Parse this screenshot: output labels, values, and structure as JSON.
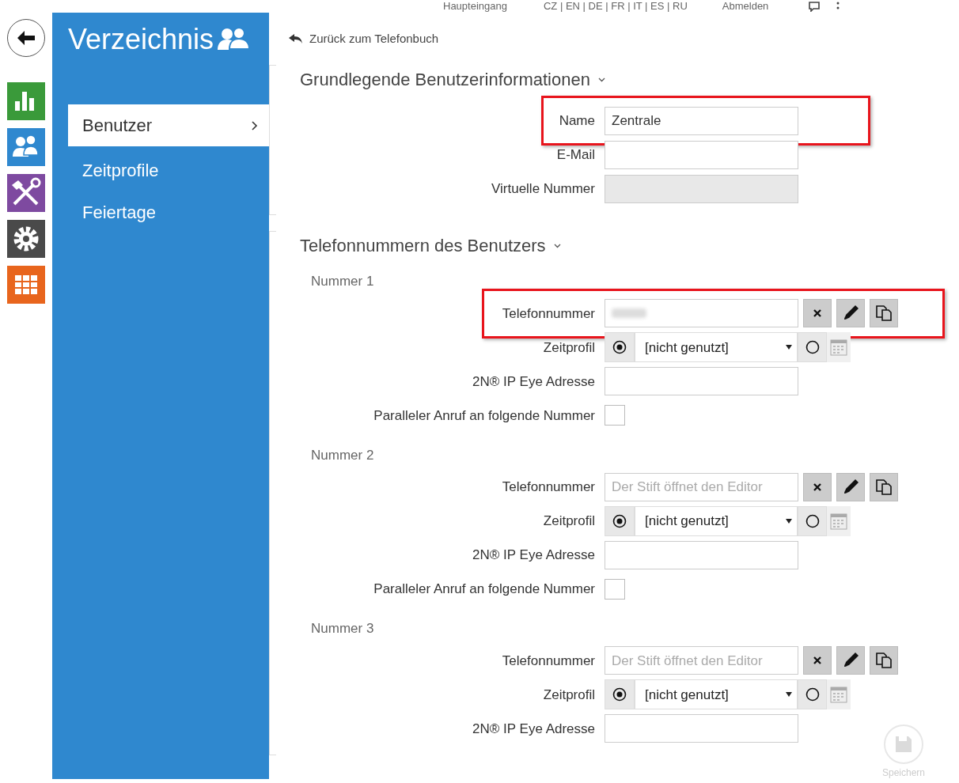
{
  "top_bar": {
    "items": [
      "Haupteingang",
      "CZ | EN | DE | FR | IT | ES | RU",
      "Abmelden"
    ]
  },
  "rail": {
    "items": [
      {
        "kind": "back"
      },
      {
        "kind": "status"
      },
      {
        "kind": "directory"
      },
      {
        "kind": "hardware"
      },
      {
        "kind": "system"
      },
      {
        "kind": "services"
      }
    ]
  },
  "sidebar": {
    "title": "Verzeichnis",
    "items": [
      {
        "label": "Benutzer",
        "selected": true
      },
      {
        "label": "Zeitprofile",
        "selected": false
      },
      {
        "label": "Feiertage",
        "selected": false
      }
    ]
  },
  "back_link": "Zurück zum Telefonbuch",
  "sections": [
    {
      "title": "Grundlegende Benutzerinformationen",
      "groups": [
        {
          "rows": [
            {
              "kind": "text",
              "label": "Name",
              "value": "Zentrale",
              "highlighted": true
            },
            {
              "kind": "text",
              "label": "E-Mail",
              "highlighted": false
            },
            {
              "kind": "disabled",
              "label": "Virtuelle Nummer",
              "highlighted": false
            }
          ]
        }
      ]
    },
    {
      "title": "Telefonnummern des Benutzers",
      "groups": [
        {
          "title": "Nummer 1",
          "rows": [
            {
              "kind": "phone",
              "label": "Telefonnummer",
              "blurred": true,
              "highlighted": true
            },
            {
              "kind": "profile",
              "label": "Zeitprofil",
              "value": "[nicht genutzt]",
              "radios": [
                {
                  "selected": true
                },
                {
                  "selected": false
                }
              ],
              "highlighted": false
            },
            {
              "kind": "text",
              "label": "2N® IP Eye Adresse",
              "highlighted": false
            },
            {
              "kind": "checkbox",
              "label": "Paralleler Anruf an folgende Nummer",
              "checked": false,
              "highlighted": false
            }
          ]
        },
        {
          "title": "Nummer 2",
          "rows": [
            {
              "kind": "phone",
              "label": "Telefonnummer",
              "placeholder": "Der Stift öffnet den Editor",
              "blurred": false,
              "highlighted": false
            },
            {
              "kind": "profile",
              "label": "Zeitprofil",
              "value": "[nicht genutzt]",
              "radios": [
                {
                  "selected": true
                },
                {
                  "selected": false
                }
              ],
              "highlighted": false
            },
            {
              "kind": "text",
              "label": "2N® IP Eye Adresse",
              "highlighted": false
            },
            {
              "kind": "checkbox",
              "label": "Paralleler Anruf an folgende Nummer",
              "checked": false,
              "highlighted": false
            }
          ]
        },
        {
          "title": "Nummer 3",
          "rows": [
            {
              "kind": "phone",
              "label": "Telefonnummer",
              "placeholder": "Der Stift öffnet den Editor",
              "blurred": false,
              "highlighted": false
            },
            {
              "kind": "profile",
              "label": "Zeitprofil",
              "value": "[nicht genutzt]",
              "radios": [
                {
                  "selected": true
                },
                {
                  "selected": false
                }
              ],
              "highlighted": false
            },
            {
              "kind": "text",
              "label": "2N® IP Eye Adresse",
              "highlighted": false
            }
          ]
        }
      ]
    }
  ],
  "save_button": {
    "label": "Speichern",
    "disabled": true
  }
}
